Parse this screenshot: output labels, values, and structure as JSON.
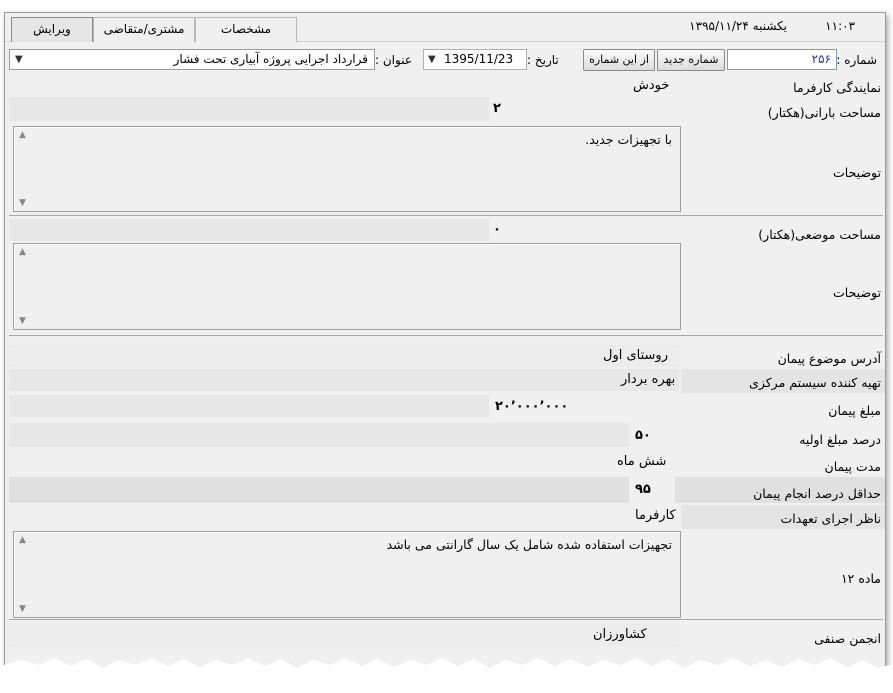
{
  "header": {
    "time": "۱۱:۰۳",
    "date_text": "یکشنبه ۱۳۹۵/۱۱/۲۴",
    "tabs": [
      {
        "label": "ویرایش",
        "active": true
      },
      {
        "label": "مشتری/متقاضی",
        "active": false
      },
      {
        "label": "مشخصات",
        "active": false
      }
    ]
  },
  "toolbar": {
    "number_label": "شماره :",
    "number_value": "۲۵۶",
    "new_number_button": "شماره جدید",
    "from_this_number_button": "از این شماره",
    "date_label": "تاریخ :",
    "date_value": "1395/11/23",
    "title_label": "عنوان :",
    "title_value": "قرارداد اجرایی پروژه آبیاری تحت فشار"
  },
  "form": {
    "employer_rep": {
      "label": "نمایندگی کارفرما",
      "value": "خودش"
    },
    "rain_area": {
      "label": "مساحت بارانی(هکتار)",
      "value": "۲"
    },
    "desc1": {
      "label": "توضیحات",
      "value": "با تجهیزات جدید."
    },
    "local_area": {
      "label": "مساحت موضعی(هکتار)",
      "value": "۰"
    },
    "desc2": {
      "label": "توضیحات",
      "value": ""
    },
    "address": {
      "label": "آدرس موضوع پیمان",
      "value": "روستای اول"
    },
    "central_system": {
      "label": "تهیه کننده سیستم مرکزی",
      "value": "بهره بردار"
    },
    "contract_amount": {
      "label": "مبلغ پیمان",
      "value": "۲۰٬۰۰۰٬۰۰۰"
    },
    "initial_percent": {
      "label": "درصد مبلغ اولیه",
      "value": "۵۰"
    },
    "duration": {
      "label": "مدت پیمان",
      "value": "شش ماه"
    },
    "min_percent": {
      "label": "حداقل درصد انجام پیمان",
      "value": "۹۵"
    },
    "supervisor": {
      "label": "ناظر اجرای تعهدات",
      "value": "کارفرما"
    },
    "article12": {
      "label": "ماده ۱۲",
      "value": "تجهیزات استفاده شده شامل یک سال گارانتی می باشد"
    },
    "union": {
      "label": "انجمن صنفی",
      "value": "کشاورزان"
    }
  }
}
